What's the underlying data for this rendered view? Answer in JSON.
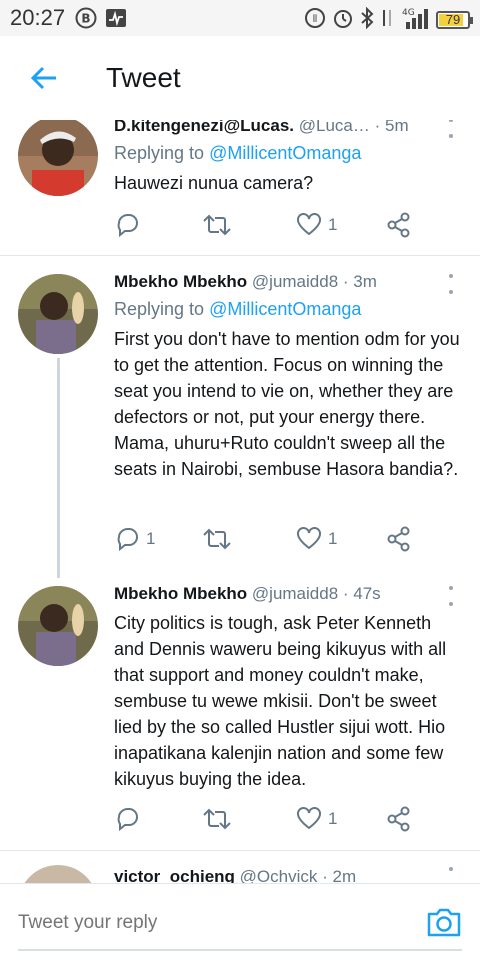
{
  "status_bar": {
    "time": "20:27",
    "battery_level": "79",
    "network": "4G"
  },
  "header": {
    "title": "Tweet"
  },
  "tweets": [
    {
      "name": "D.kitengenezi@Lucas.",
      "handle": "@Luca…",
      "time": "· 5m",
      "reply_prefix": "Replying to ",
      "reply_to": "@MillicentOmanga",
      "text": "Hauwezi nunua camera?",
      "reply_count": "",
      "like_count": "1"
    },
    {
      "name": "Mbekho Mbekho",
      "handle": "@jumaidd8",
      "time": "· 3m",
      "reply_prefix": "Replying to ",
      "reply_to": "@MillicentOmanga",
      "text": "First you don't have to mention odm for you to get the attention. Focus on winning the seat you intend to vie on, whether they are defectors or not, put your energy there. Mama, uhuru+Ruto couldn't sweep all the seats in Nairobi, sembuse Hasora bandia?.",
      "reply_count": "1",
      "like_count": "1"
    },
    {
      "name": "Mbekho Mbekho",
      "handle": "@jumaidd8",
      "time": "· 47s",
      "text": "City politics is tough, ask Peter Kenneth and Dennis waweru being kikuyus with all that support and money couldn't make, sembuse tu wewe mkisii. Don't be sweet lied by the so called Hustler sijui wott. Hio inapatikana kalenjin nation and some few kikuyus buying the idea.",
      "reply_count": "",
      "like_count": "1"
    },
    {
      "name": "victor_ochieng",
      "handle": "@Ochvick",
      "time": "· 2m"
    }
  ],
  "reply_bar": {
    "placeholder": "Tweet your reply"
  },
  "colors": {
    "accent": "#1da1f2",
    "secondary_text": "#657786",
    "divider": "#e1e8ed"
  }
}
